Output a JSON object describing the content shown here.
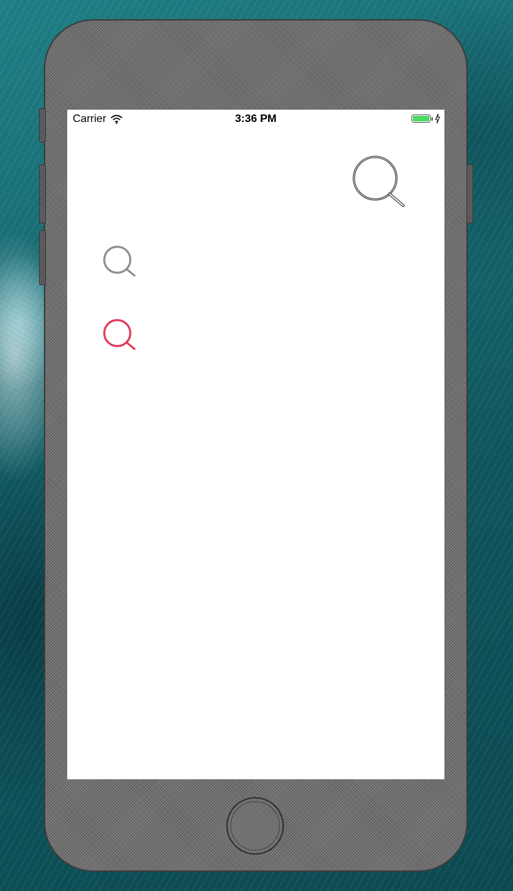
{
  "status_bar": {
    "carrier": "Carrier",
    "time": "3:36 PM",
    "battery_level": 1.0,
    "battery_color": "#4cd964"
  },
  "icons": {
    "large_search": {
      "name": "search-icon",
      "style": "outline",
      "color": "#222222"
    },
    "gray_search": {
      "name": "search-icon",
      "color": "#8a8f90"
    },
    "red_search": {
      "name": "search-icon",
      "color": "#e0395a"
    }
  }
}
